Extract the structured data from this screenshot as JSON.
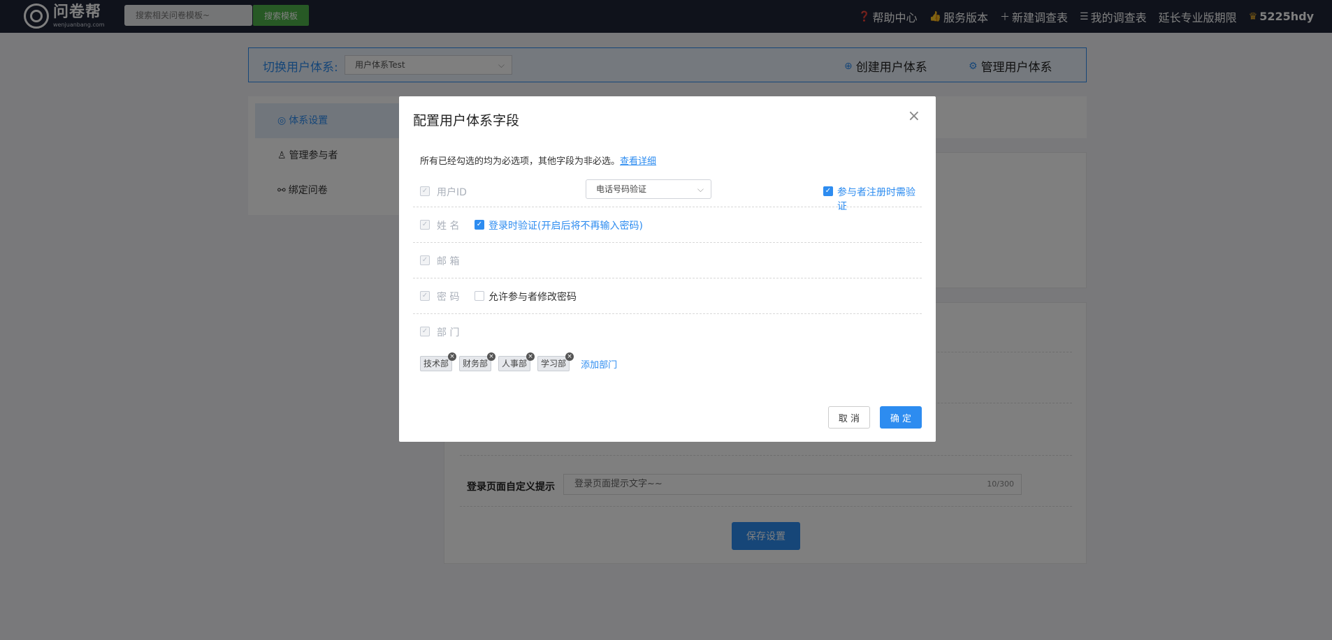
{
  "header": {
    "logo_name": "问卷帮",
    "logo_sub": "wenjuanbang.com",
    "search_placeholder": "搜索相关问卷模板~",
    "search_button": "搜索模板",
    "nav": {
      "help": "帮助中心",
      "service": "服务版本",
      "new_survey": "新建调查表",
      "my_surveys": "我的调查表",
      "extend": "延长专业版期限",
      "user": "5225hdy"
    }
  },
  "switch_bar": {
    "label": "切换用户体系:",
    "selected": "用户体系Test",
    "create": "创建用户体系",
    "manage": "管理用户体系"
  },
  "sidebar": {
    "items": [
      {
        "label": "体系设置",
        "icon": "settings-icon",
        "active": true
      },
      {
        "label": "管理参与者",
        "icon": "user-icon",
        "active": false
      },
      {
        "label": "绑定问卷",
        "icon": "link-icon",
        "active": false
      }
    ]
  },
  "main": {
    "login_tip_label": "登录页面自定义提示",
    "login_tip_value": "登录页面提示文字~~",
    "login_tip_count": "10/300",
    "save_button": "保存设置"
  },
  "modal": {
    "title": "配置用户体系字段",
    "description": "所有已经勾选的均为必选项，其他字段为非必选。",
    "detail_link": "查看详细",
    "fields": {
      "user_id": {
        "name": "用户ID",
        "verify_select": "电话号码验证",
        "register_verify": "参与者注册时需验证"
      },
      "name": {
        "name": "姓 名",
        "login_verify": "登录时验证(开启后将不再输入密码)"
      },
      "email": {
        "name": "邮 箱"
      },
      "password": {
        "name": "密 码",
        "allow_change": "允许参与者修改密码"
      },
      "dept": {
        "name": "部 门"
      }
    },
    "departments": [
      "技术部",
      "财务部",
      "人事部",
      "学习部"
    ],
    "add_department": "添加部门",
    "cancel": "取 消",
    "confirm": "确 定"
  }
}
